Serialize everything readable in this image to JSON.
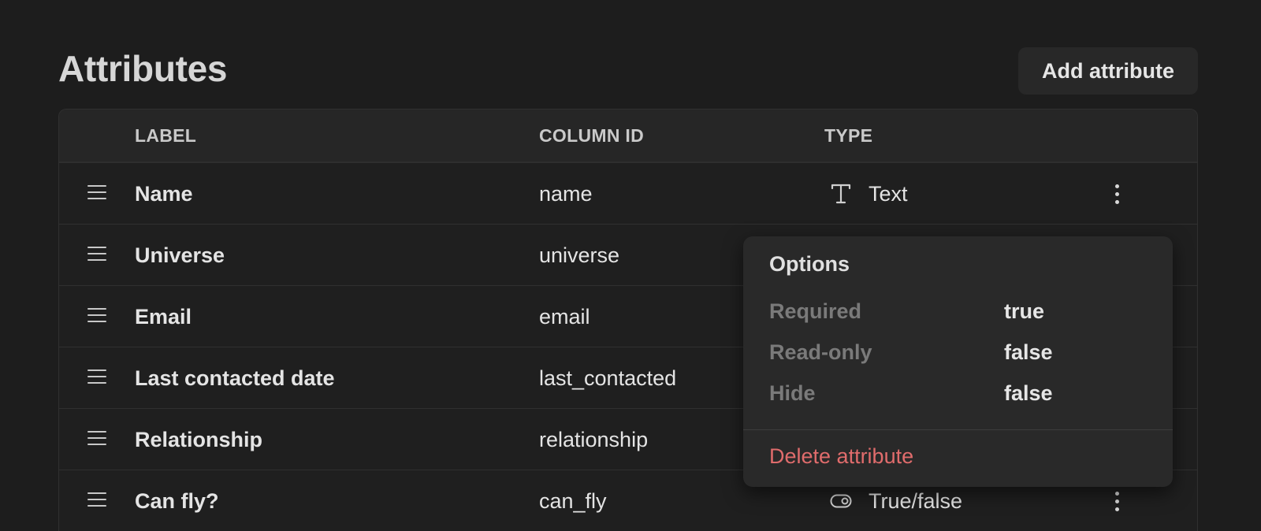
{
  "header": {
    "title": "Attributes",
    "add_button": "Add attribute"
  },
  "table": {
    "columns": [
      "LABEL",
      "COLUMN ID",
      "TYPE"
    ],
    "rows": [
      {
        "label": "Name",
        "column_id": "name",
        "type": "Text",
        "type_icon": "text-type-icon"
      },
      {
        "label": "Universe",
        "column_id": "universe",
        "type": "",
        "type_icon": ""
      },
      {
        "label": "Email",
        "column_id": "email",
        "type": "",
        "type_icon": ""
      },
      {
        "label": "Last contacted date",
        "column_id": "last_contacted",
        "type": "",
        "type_icon": ""
      },
      {
        "label": "Relationship",
        "column_id": "relationship",
        "type": "",
        "type_icon": ""
      },
      {
        "label": "Can fly?",
        "column_id": "can_fly",
        "type": "True/false",
        "type_icon": "toggle-icon"
      }
    ]
  },
  "options_menu": {
    "title": "Options",
    "items": [
      {
        "key": "Required",
        "value": "true"
      },
      {
        "key": "Read-only",
        "value": "false"
      },
      {
        "key": "Hide",
        "value": "false"
      }
    ],
    "delete_label": "Delete attribute",
    "delete_color": "#e06c6c"
  }
}
